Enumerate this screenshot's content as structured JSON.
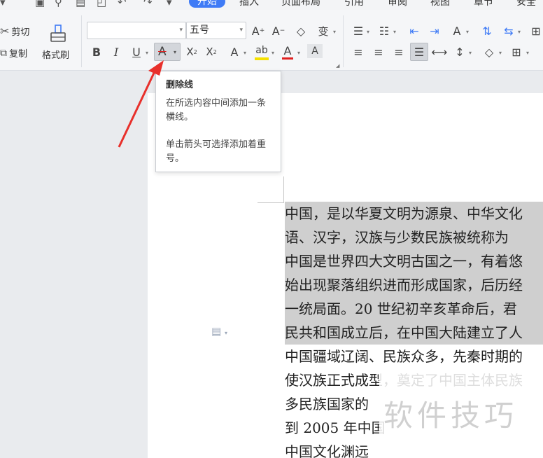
{
  "quick_access": {
    "tabs": [
      {
        "label": "开始",
        "active": true
      },
      {
        "label": "插入",
        "active": false
      },
      {
        "label": "页面布局",
        "active": false
      },
      {
        "label": "引用",
        "active": false
      },
      {
        "label": "审阅",
        "active": false
      },
      {
        "label": "视图",
        "active": false
      },
      {
        "label": "章节",
        "active": false
      },
      {
        "label": "安全",
        "active": false
      }
    ]
  },
  "ribbon": {
    "cut_label": "剪切",
    "copy_label": "复制",
    "format_painter_label": "格式刷",
    "font_name": "",
    "font_size": "五号"
  },
  "tooltip": {
    "title": "删除线",
    "line1": "在所选内容中间添加一条横线。",
    "line2": "单击箭头可选择添加着重号。"
  },
  "document": {
    "lines": [
      {
        "text": "中国，是以华夏文明为源泉、中华文化",
        "selected": true
      },
      {
        "text": "语、汉字，汉族与少数民族被统称为",
        "selected": true
      },
      {
        "text": "中国是世界四大文明古国之一，有着悠",
        "selected": true
      },
      {
        "text": "始出现聚落组织进而形成国家，后历经",
        "selected": true
      },
      {
        "text": "一统局面。20 世纪初辛亥革命后，君",
        "selected": true
      },
      {
        "text": "民共和国成立后，在中国大陆建立了人",
        "selected": true
      },
      {
        "text": "中国疆域辽阔、民族众多，先秦时期的",
        "selected": false
      },
      {
        "text": "使汉族正式成型，奠定了中国主体民族",
        "selected": false
      },
      {
        "text": "多民族国家的",
        "selected": false
      },
      {
        "text": "到 2005 年中国",
        "selected": false
      },
      {
        "text": "中国文化渊远",
        "selected": false
      }
    ]
  },
  "watermark": "软件技巧",
  "colors": {
    "accent": "#3f7bf6",
    "font_color_bar": "#e02020",
    "highlight_bar": "#f5e000",
    "selection": "#cfcfcf",
    "arrow": "#e8302b"
  }
}
